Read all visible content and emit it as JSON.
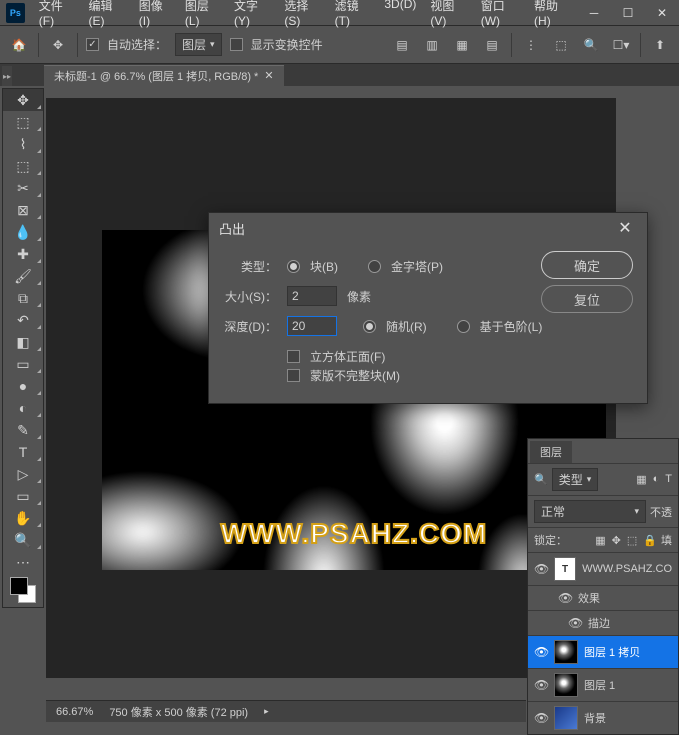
{
  "menu": [
    "文件(F)",
    "编辑(E)",
    "图像(I)",
    "图层(L)",
    "文字(Y)",
    "选择(S)",
    "滤镜(T)",
    "3D(D)",
    "视图(V)",
    "窗口(W)",
    "帮助(H)"
  ],
  "options": {
    "autoSelect": "自动选择：",
    "layerDropdown": "图层",
    "showTransform": "显示变换控件"
  },
  "docTab": "未标题-1 @ 66.7% (图层 1 拷贝, RGB/8) *",
  "watermark": "WWW.PSAHZ.COM",
  "dialog": {
    "title": "凸出",
    "typeLabel": "类型：",
    "typeBlock": "块(B)",
    "typePyramid": "金字塔(P)",
    "sizeLabel": "大小(S)：",
    "sizeValue": "2",
    "sizeUnit": "像素",
    "depthLabel": "深度(D)：",
    "depthValue": "20",
    "depthRandom": "随机(R)",
    "depthLevel": "基于色阶(L)",
    "solidFront": "立方体正面(F)",
    "maskIncomplete": "蒙版不完整块(M)",
    "ok": "确定",
    "reset": "复位"
  },
  "layers": {
    "tab": "图层",
    "kindLabel": "类型",
    "blendMode": "正常",
    "opacity": "不透",
    "lockLabel": "锁定：",
    "fill": "填",
    "items": [
      {
        "name": "WWW.PSAHZ.CO",
        "type": "T"
      },
      {
        "name": "效果",
        "type": "fx",
        "indent": true
      },
      {
        "name": "描边",
        "type": "fx",
        "indent": true
      },
      {
        "name": "图层 1 拷贝",
        "type": "clouds",
        "active": true
      },
      {
        "name": "图层 1",
        "type": "clouds"
      },
      {
        "name": "背景",
        "type": "grad"
      }
    ]
  },
  "status": {
    "zoom": "66.67%",
    "docInfo": "750 像素 x 500 像素 (72 ppi)"
  }
}
